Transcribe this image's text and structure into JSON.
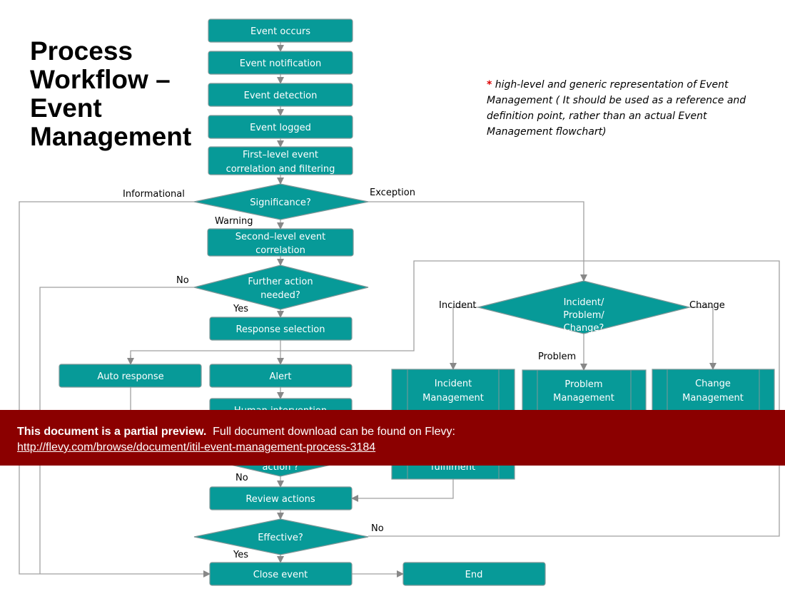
{
  "title_lines": [
    "Process",
    "Workflow –",
    "Event",
    "Management"
  ],
  "note": {
    "asterisk": "*",
    "text": " high-level and generic representation of Event Management ( It should be used as a reference and definition point, rather than an actual  Event Management flowchart)"
  },
  "nodes": {
    "event_occurs": "Event occurs",
    "event_notification": "Event notification",
    "event_detection": "Event detection",
    "event_logged": "Event logged",
    "first_level_1": "First–level event",
    "first_level_2": "correlation and filtering",
    "significance": "Significance?",
    "second_level_1": "Second–level event",
    "second_level_2": "correlation",
    "further_1": "Further action",
    "further_2": "needed?",
    "response_selection": "Response selection",
    "auto_response": "Auto response",
    "alert": "Alert",
    "human_intervention": "Human intervention",
    "action_q": "action ?",
    "review_actions": "Review actions",
    "effective": "Effective?",
    "close_event": "Close event",
    "end": "End",
    "ipc_1": "Incident/",
    "ipc_2": "Problem/",
    "ipc_3": "Change?",
    "incident_1": "Incident",
    "incident_2": "Management",
    "fulfilment": "fulfilment",
    "problem_1": "Problem",
    "problem_2": "Management",
    "change_1": "Change",
    "change_2": "Management"
  },
  "labels": {
    "informational": "Informational",
    "exception": "Exception",
    "warning": "Warning",
    "no_further": "No",
    "yes_further": "Yes",
    "incident": "Incident",
    "change": "Change",
    "problem": "Problem",
    "no_action": "No",
    "no_effective": "No",
    "yes_effective": "Yes"
  },
  "banner": {
    "bold": "This document is a partial preview.",
    "text": "  Full document download can be found on Flevy:",
    "link": "http://flevy.com/browse/document/itil-event-management-process-3184"
  },
  "colors": {
    "node": "#079a98",
    "banner": "#8b0000",
    "connector": "#a0a0a0"
  }
}
